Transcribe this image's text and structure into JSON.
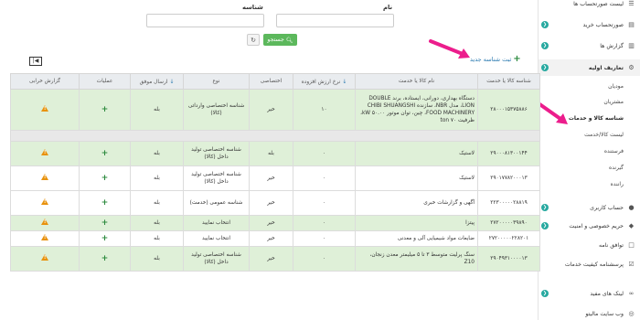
{
  "sidebar": {
    "items": [
      {
        "label": "لیست صورتحساب ها",
        "icon": "list-icon",
        "chev": false
      },
      {
        "label": "صورتحساب خرید",
        "icon": "cart-icon",
        "chev": true
      },
      {
        "label": "گزارش ها",
        "icon": "chart-icon",
        "chev": true
      },
      {
        "label": "تعاریف اولیه",
        "icon": "settings-icon",
        "chev": true,
        "active": true
      }
    ],
    "subitems": [
      {
        "label": "مودیان",
        "current": false
      },
      {
        "label": "مشتریان",
        "current": false
      },
      {
        "label": "شناسه کالا و خدمات",
        "current": true
      },
      {
        "label": "لیست کالا/خدمت",
        "current": false
      },
      {
        "label": "فرستنده",
        "current": false
      },
      {
        "label": "گیرنده",
        "current": false
      },
      {
        "label": "راننده",
        "current": false
      }
    ],
    "items_bottom": [
      {
        "label": "حساب کاربری",
        "icon": "user-icon",
        "chev": true
      },
      {
        "label": "حریم خصوصی و امنیت",
        "icon": "shield-icon",
        "chev": true
      },
      {
        "label": "توافق نامه",
        "icon": "document-icon",
        "chev": false
      },
      {
        "label": "پرسشنامه کیفیت خدمات",
        "icon": "survey-icon",
        "chev": false
      },
      {
        "label": "لینک های مفید",
        "icon": "link-icon",
        "chev": true
      },
      {
        "label": "وب سایت مالیتو",
        "icon": "globe-icon",
        "chev": false
      }
    ]
  },
  "search": {
    "name_label": "نام",
    "id_label": "شناسه",
    "search_button": "جستجو",
    "search_icon": "search-icon",
    "reset_icon": "refresh-icon"
  },
  "actions": {
    "add_new": "ثبت شناسه جدید",
    "toggle_icon": "panel-toggle-icon"
  },
  "table": {
    "headers": [
      "شناسه کالا یا خدمت",
      "نام کالا یا خدمت",
      "نرخ ارزش افزوده",
      "اختصاصی",
      "نوع",
      "ارسال موفق",
      "عملیات",
      "گزارش خرابی"
    ],
    "rows": [
      {
        "id": "۲۸۰۰۰۱۵۳۷۵۸۸۶",
        "name": "دستگاه بهداری، دورانی، ایستاده، برند DOUBLE LION، مدل NBR، سازنده CHIBI SHUANGSHI FOOD MACHINERY، چین، توان موتور ۵۰.۰۰ kW، ظرفیت ۷۰ ton",
        "rate": "۱۰",
        "exclusive": "خیر",
        "type": "شناسه اختصاصی وارداتی (کالا)",
        "sent": "بله",
        "style": "green"
      },
      {
        "id": "",
        "name": "",
        "rate": "",
        "exclusive": "",
        "type": "",
        "sent": "",
        "style": "sep"
      },
      {
        "id": "۲۹۰۰۰۸۱۳۰۰۱۴۴",
        "name": "لاستیک",
        "rate": "۰",
        "exclusive": "بله",
        "type": "شناسه اختصاصی تولید داخل (کالا)",
        "sent": "بله",
        "style": "green"
      },
      {
        "id": "۲۹۰۱۷۷۸۲۰۰۰۱۳",
        "name": "لاستیک",
        "rate": "۰",
        "exclusive": "خیر",
        "type": "شناسه اختصاصی تولید داخل (کالا)",
        "sent": "بله",
        "style": "white"
      },
      {
        "id": "۲۲۳۰۰۰۰۰۲۸۸۱۹",
        "name": "آگهی و گزارشات خبری",
        "rate": "۰",
        "exclusive": "خیر",
        "type": "شناسه عمومی (خدمت)",
        "sent": "بله",
        "style": "white"
      },
      {
        "id": "۲۷۲۰۰۰۰۰۳۹۸۹۰",
        "name": "پیتزا",
        "rate": "۰",
        "exclusive": "خیر",
        "type": "انتخاب نمایید",
        "sent": "بله",
        "style": "green"
      },
      {
        "id": "۲۷۲۰۰۰۰۰۲۲۸۲۰۱",
        "name": "ضایعات مواد شیمیایی آلی و معدنی",
        "rate": "۰",
        "exclusive": "خیر",
        "type": "انتخاب نمایید",
        "sent": "بله",
        "style": "white"
      },
      {
        "id": "۲۹۰۴۹۳۱۰۰۰۰۱۳",
        "name": "سنگ پرلیت متوسط ۳ تا ۵ میلیمتر معدن زنجان، Z10",
        "rate": "۰",
        "exclusive": "خیر",
        "type": "شناسه اختصاصی تولید داخل (کالا)",
        "sent": "بله",
        "style": "green"
      }
    ]
  },
  "colors": {
    "accent": "#27a9a0",
    "success": "#5cb85c",
    "row_green": "#dff0d8",
    "warning": "#e8920c",
    "arrow": "#ec1d8c"
  }
}
